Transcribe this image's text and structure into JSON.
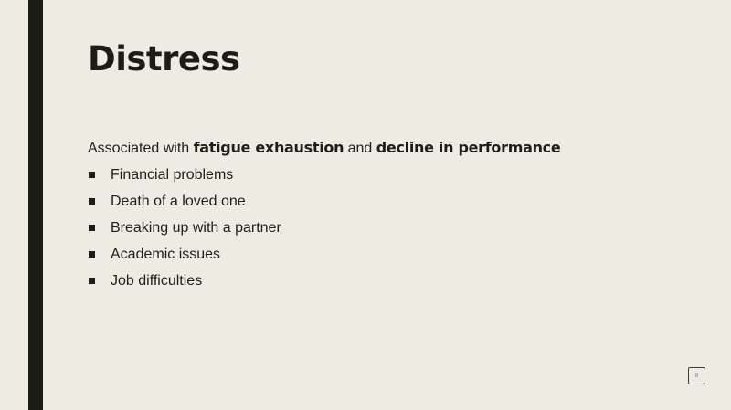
{
  "slide": {
    "title": "Distress",
    "intro": {
      "prefix": "Associated with ",
      "strong1": "fatigue exhaustion",
      "middle": " and ",
      "strong2": "decline in performance"
    },
    "bullets": [
      "Financial problems",
      "Death of a loved one",
      "Breaking up with a partner",
      "Academic issues",
      "Job difficulties"
    ],
    "page_number": "8"
  },
  "colors": {
    "background": "#eeebe2",
    "accent_bar": "#1c1d14",
    "text": "#1f1f18"
  }
}
